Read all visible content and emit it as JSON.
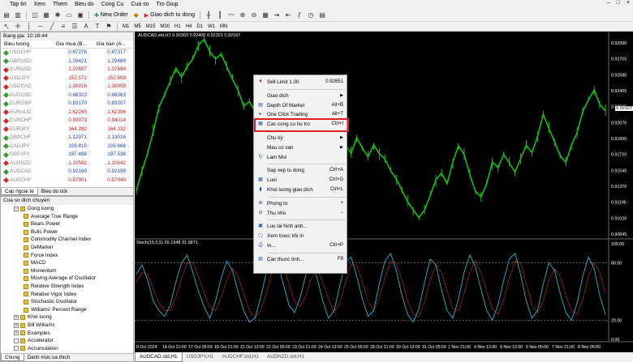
{
  "menubar": [
    "Tap tin",
    "Xem",
    "Them",
    "Bieu do",
    "Cong Cu",
    "Cua so",
    "Tro Giup"
  ],
  "window_controls": [
    "–",
    "□",
    "×"
  ],
  "toolbar": {
    "new_order": "New Order",
    "autotrade": "Giao dich tu dong",
    "timeframes": [
      "M1",
      "M5",
      "M15",
      "M30",
      "H1",
      "H4",
      "D1",
      "W1",
      "MN"
    ]
  },
  "market_watch": {
    "title": "Bang gia: 10:16:44",
    "headers": [
      "Bieu tuong",
      "Gia mua (B...",
      "Gia ban (A..."
    ],
    "rows": [
      {
        "symbol": "USDCHF",
        "bid": "0.87276",
        "ask": "0.87317",
        "color": "#1a3fd0"
      },
      {
        "symbol": "GBPUSD",
        "bid": "1.29421",
        "ask": "1.29460",
        "color": "#1a3fd0"
      },
      {
        "symbol": "EURUSD",
        "bid": "1.07657",
        "ask": "1.07690",
        "color": "#d01a1a"
      },
      {
        "symbol": "USDJPY",
        "bid": "152.572",
        "ask": "152.609",
        "color": "#d01a1a"
      },
      {
        "symbol": "USDCAD",
        "bid": "1.38916",
        "ask": "1.38959",
        "color": "#d01a1a"
      },
      {
        "symbol": "AUDUSD",
        "bid": "0.66322",
        "ask": "0.66363",
        "color": "#1a3fd0"
      },
      {
        "symbol": "EURGBP",
        "bid": "0.83170",
        "ask": "0.83207",
        "color": "#1a3fd0"
      },
      {
        "symbol": "EURAUD",
        "bid": "1.62265",
        "ask": "1.62306",
        "color": "#d01a1a"
      },
      {
        "symbol": "EURCHF",
        "bid": "0.93973",
        "ask": "0.94014",
        "color": "#d01a1a"
      },
      {
        "symbol": "EURJPY",
        "bid": "164.282",
        "ask": "164.332",
        "color": "#d01a1a"
      },
      {
        "symbol": "GBPCHF",
        "bid": "1.12971",
        "ask": "1.13016",
        "color": "#1a3fd0"
      },
      {
        "symbol": "CADJPY",
        "bid": "109.815",
        "ask": "109.868",
        "color": "#1a3fd0"
      },
      {
        "symbol": "GBPJPY",
        "bid": "197.488",
        "ask": "197.538",
        "color": "#1a3fd0"
      },
      {
        "symbol": "AUDNZD",
        "bid": "1.10582",
        "ask": "1.10642",
        "color": "#d01a1a"
      },
      {
        "symbol": "AUDCAD",
        "bid": "0.92160",
        "ask": "0.92199",
        "color": "#1a3fd0"
      },
      {
        "symbol": "AUDCHF",
        "bid": "0.57901",
        "ask": "0.57940",
        "color": "#d01a1a"
      }
    ],
    "tabs": [
      "Cap ngoai te",
      "Bieu do tick"
    ]
  },
  "navigator": {
    "title": "Cua so dich chuyen",
    "items": [
      {
        "label": "Dong luong",
        "level": 1,
        "expand": "−"
      },
      {
        "label": "Average True Range",
        "level": 2
      },
      {
        "label": "Bears Power",
        "level": 2
      },
      {
        "label": "Bulls Power",
        "level": 2
      },
      {
        "label": "Commodity Channel Index",
        "level": 2
      },
      {
        "label": "DeMarker",
        "level": 2
      },
      {
        "label": "Force Index",
        "level": 2
      },
      {
        "label": "MACD",
        "level": 2
      },
      {
        "label": "Momentum",
        "level": 2
      },
      {
        "label": "Moving Average of Oscillator",
        "level": 2
      },
      {
        "label": "Relative Strength Index",
        "level": 2
      },
      {
        "label": "Relative Vigor Index",
        "level": 2
      },
      {
        "label": "Stochastic Oscillator",
        "level": 2
      },
      {
        "label": "Williams' Percent Range",
        "level": 2
      },
      {
        "label": "Khoi luong",
        "level": 1,
        "expand": "+"
      },
      {
        "label": "Bill Williams",
        "level": 1,
        "expand": "+"
      },
      {
        "label": "Examples",
        "level": 1,
        "expand": "+"
      },
      {
        "label": "Accelerator",
        "level": 1,
        "expand": ""
      },
      {
        "label": "Accumulation",
        "level": 1,
        "expand": ""
      }
    ],
    "tabs": [
      "Chung",
      "Danh muc ua thich"
    ]
  },
  "chart": {
    "title": "AUDCAD.std,H1  0.92363 0.92400 0.92321 0.92167",
    "stoch_title": "Stoch(15,5,5) 26.1948 31.9871",
    "current_price": "0.92167",
    "price_labels": [
      "0.92930",
      "0.92755",
      "0.92580",
      "0.92405",
      "0.92245",
      "0.92070",
      "0.91895",
      "0.91720",
      "0.91545",
      "0.91370",
      "0.91195",
      "0.91020",
      "0.90845"
    ],
    "stoch_labels": [
      "100.00",
      "80.00",
      "20.00",
      "0.00"
    ],
    "time_labels": [
      "8 Oct 2024",
      "14 Oct 21:00",
      "17 Oct 05:00",
      "18 Oct 21:00",
      "21 Oct 13:00",
      "22 Oct 05:00",
      "23 Oct 21:00",
      "24 Oct 13:00",
      "25 Oct 05:00",
      "28 Oct 21:00",
      "30 Oct 13:00",
      "31 Oct 05:00",
      "1 Nov 21:00",
      "4 Nov 13:00",
      "5 Nov 13:00",
      "6 Nov 05:00",
      "7 Nov 21:00",
      "8 Nov 05:00"
    ],
    "tabs": [
      "AUDCAD.std,H1",
      "USDJPY,H1",
      "AUDCHF.std,H1",
      "AUDNZD.std,H1"
    ],
    "colors": {
      "price_line": "#11c011",
      "stoch_main": "#26b5c8",
      "stoch_signal": "#e03030"
    }
  },
  "chart_data": {
    "type": "line",
    "price_series": [
      0.913,
      0.9152,
      0.9171,
      0.9195,
      0.9218,
      0.9232,
      0.9247,
      0.9258,
      0.925,
      0.9262,
      0.9271,
      0.9283,
      0.929,
      0.9278,
      0.9268,
      0.9274,
      0.9262,
      0.925,
      0.9236,
      0.922,
      0.9226,
      0.9213,
      0.9188,
      0.9195,
      0.9178,
      0.916,
      0.9149,
      0.9138,
      0.914,
      0.9152,
      0.9164,
      0.9172,
      0.9181,
      0.9175,
      0.9182,
      0.919,
      0.9184,
      0.918,
      0.9172,
      0.9186,
      0.9176,
      0.9168,
      0.9178,
      0.917,
      0.9165,
      0.9154,
      0.9143,
      0.9132,
      0.9121,
      0.911,
      0.9103,
      0.9112,
      0.9128,
      0.9142,
      0.915,
      0.914,
      0.916,
      0.9178,
      0.917,
      0.915,
      0.913,
      0.9125,
      0.914,
      0.916,
      0.9155,
      0.917,
      0.9162,
      0.915,
      0.9165,
      0.918,
      0.917,
      0.9188,
      0.9212,
      0.9198,
      0.9182,
      0.9168,
      0.9162,
      0.9178,
      0.9192,
      0.9215,
      0.9228,
      0.9236,
      0.9222,
      0.9216
    ],
    "stoch_main": [
      68,
      78,
      62,
      40,
      30,
      24,
      36,
      60,
      80,
      88,
      70,
      50,
      34,
      22,
      40,
      64,
      82,
      72,
      50,
      30,
      18,
      22,
      44,
      70,
      90,
      80,
      58,
      36,
      28,
      44,
      68,
      80,
      64,
      40,
      22,
      30,
      56,
      80,
      86,
      66,
      42,
      24,
      30,
      58,
      82,
      90,
      72,
      46,
      26,
      18,
      32,
      60,
      84,
      78,
      52,
      30,
      22,
      42,
      70,
      88,
      76,
      52,
      30,
      20,
      36,
      62,
      84,
      90,
      68,
      40,
      22,
      30,
      58,
      80,
      72,
      48,
      28,
      20,
      38,
      66,
      86,
      74,
      46,
      26
    ],
    "stoch_signal": [
      60,
      70,
      68,
      52,
      38,
      30,
      30,
      44,
      64,
      80,
      80,
      66,
      48,
      34,
      30,
      44,
      62,
      74,
      66,
      48,
      30,
      22,
      30,
      48,
      70,
      82,
      76,
      58,
      40,
      34,
      46,
      64,
      72,
      60,
      42,
      28,
      38,
      60,
      78,
      78,
      60,
      40,
      30,
      44,
      64,
      82,
      80,
      62,
      40,
      26,
      24,
      40,
      62,
      78,
      70,
      50,
      32,
      30,
      48,
      70,
      82,
      70,
      50,
      32,
      26,
      42,
      64,
      82,
      80,
      58,
      36,
      28,
      40,
      62,
      74,
      66,
      46,
      30,
      26,
      42,
      66,
      80,
      70,
      48
    ],
    "price_ylim": [
      0.90845,
      0.9293
    ],
    "stoch_ylim": [
      0,
      100
    ],
    "grid": false
  },
  "context_menu": {
    "items": [
      {
        "label": "Sell Limit 1.00",
        "shortcut": "0.92651",
        "icon": "sell-limit-icon"
      },
      {
        "sep": true
      },
      {
        "label": "Giao dich",
        "shortcut": "",
        "submenu": true,
        "icon": ""
      },
      {
        "label": "Depth Of Market",
        "shortcut": "Alt+B",
        "icon": "depth-of-market-icon"
      },
      {
        "label": "One Click Trading",
        "shortcut": "Alt+T",
        "icon": "one-click-trading-icon"
      },
      {
        "label": "Cac cong cu ho tro",
        "shortcut": "Ctrl+I",
        "icon": "indicators-list-icon"
      },
      {
        "sep": true
      },
      {
        "label": "Chu kỳ",
        "shortcut": "",
        "submenu": true,
        "icon": ""
      },
      {
        "label": "Mau co san",
        "shortcut": "",
        "submenu": true,
        "icon": ""
      },
      {
        "label": "Lam Moi",
        "shortcut": "",
        "icon": "refresh-icon"
      },
      {
        "sep": true
      },
      {
        "label": "Sap xep tu dong",
        "shortcut": "Ctrl+A",
        "icon": ""
      },
      {
        "label": "Luoi",
        "shortcut": "Ctrl+G",
        "icon": "grid-icon"
      },
      {
        "label": "Khoi luong giao dich",
        "shortcut": "Ctrl+L",
        "icon": "volume-icon"
      },
      {
        "sep": true
      },
      {
        "label": "Phong to",
        "shortcut": "+",
        "icon": "zoom-in-icon"
      },
      {
        "label": "Thu nho",
        "shortcut": "−",
        "icon": "zoom-out-icon"
      },
      {
        "sep": true
      },
      {
        "label": "Luu lai hinh anh...",
        "shortcut": "",
        "icon": "save-image-icon"
      },
      {
        "label": "Xem truoc khi in",
        "shortcut": "",
        "icon": "print-preview-icon"
      },
      {
        "label": "In...",
        "shortcut": "Ctrl+P",
        "icon": "print-icon"
      },
      {
        "sep": true
      },
      {
        "label": "Cac thuoc tinh...",
        "shortcut": "F8",
        "icon": "properties-icon"
      }
    ]
  }
}
